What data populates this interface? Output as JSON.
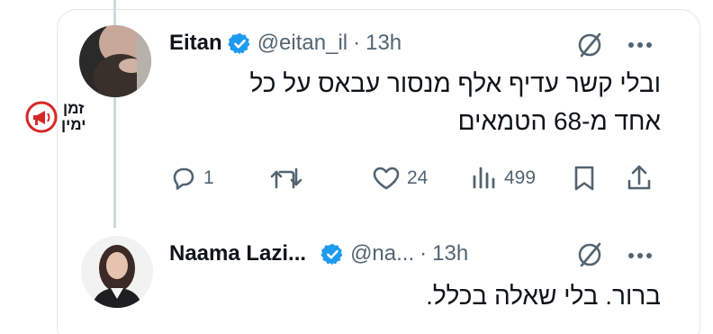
{
  "watermark": {
    "line1": "זמן",
    "line2": "ימין"
  },
  "tweet1": {
    "name": "Eitan",
    "handle": "@eitan_il",
    "separator": "·",
    "time": "13h",
    "body_line1": "ובלי קשר עדיף אלף מנסור עבאס על כל",
    "body_line2": "אחד מ-68 הטמאים",
    "replies": "1",
    "retweets": "",
    "likes": "24",
    "views": "499"
  },
  "tweet2": {
    "name": "Naama Lazi...",
    "handle": "@na...",
    "separator": "·",
    "time": "13h",
    "body": "ברור. בלי שאלה בכלל."
  },
  "icons": {
    "verified": "verified-badge-icon",
    "grok": "grok-icon",
    "more": "more-icon",
    "reply": "reply-icon",
    "retweet": "retweet-icon",
    "like": "like-icon",
    "views": "views-icon",
    "bookmark": "bookmark-icon",
    "share": "share-icon"
  },
  "colors": {
    "verified_blue": "#1d9bf0",
    "secondary_text": "#536471",
    "watermark_red": "#d62828"
  }
}
